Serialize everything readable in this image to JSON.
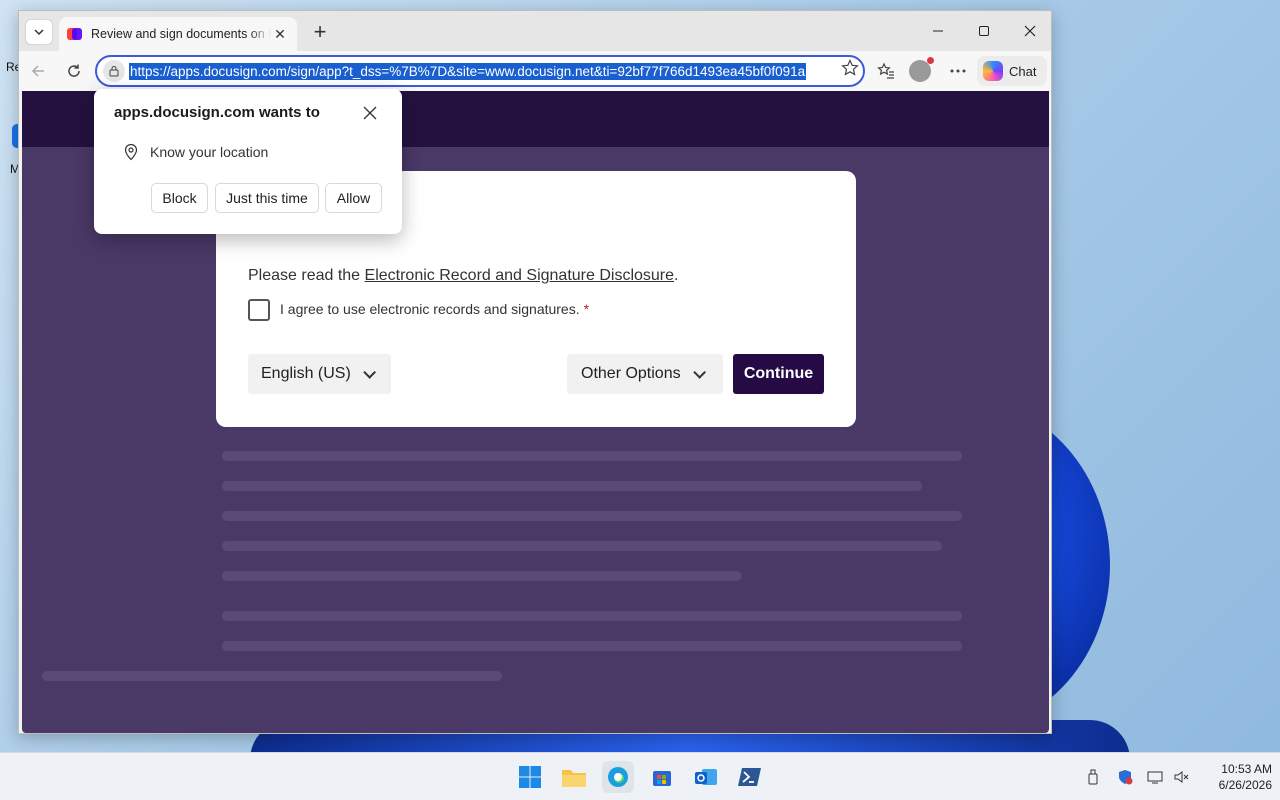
{
  "desktop": {
    "label_top": "Re",
    "label_bottom": "M"
  },
  "browser": {
    "tab": {
      "title": "Review and sign documents on DocuSign"
    },
    "url": "https://apps.docusign.com/sign/app?t_dss=%7B%7D&site=www.docusign.net&ti=92bf77f766d1493ea45bf0f091a",
    "copilot_label": "Chat"
  },
  "permission_prompt": {
    "title": "apps.docusign.com wants to",
    "request": "Know your location",
    "block_label": "Block",
    "once_label": "Just this time",
    "allow_label": "Allow"
  },
  "disclosure_card": {
    "intro": "Please read the ",
    "link_text": "Electronic Record and Signature Disclosure",
    "period": ".",
    "agree_label": "I agree to use electronic records and signatures.",
    "required_mark": "*",
    "language_label": "English (US)",
    "other_options_label": "Other Options",
    "continue_label": "Continue"
  },
  "taskbar": {
    "time": "10:53 AM",
    "date": "6/26/2026"
  },
  "colors": {
    "accent_blue": "#3b5bdb",
    "docusign_purple": "#260a46",
    "page_overlay": "#4a3866",
    "required_red": "#c21c1c"
  }
}
